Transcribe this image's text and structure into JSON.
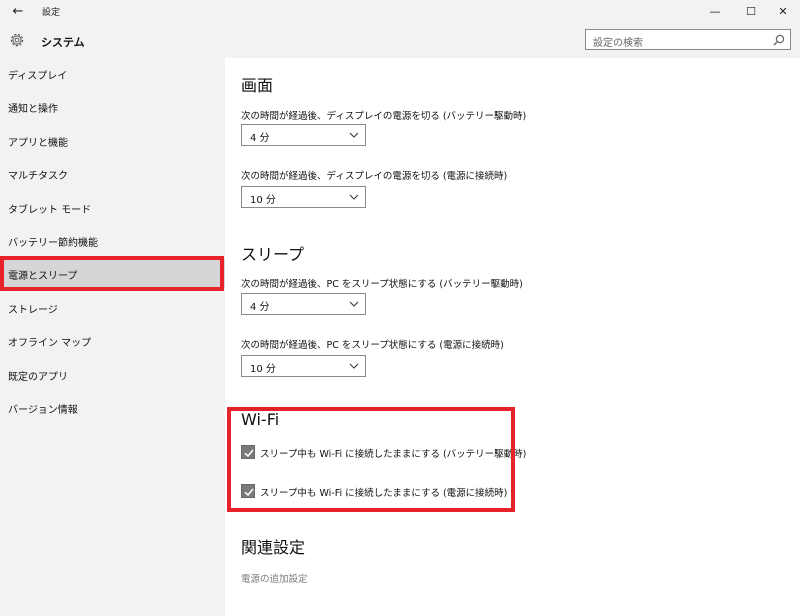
{
  "window": {
    "back_glyph": "←",
    "title": "設定",
    "minimize_glyph": "—",
    "maximize_glyph": "☐",
    "close_glyph": "✕"
  },
  "header": {
    "icon": "gear-icon",
    "title": "システム",
    "search_placeholder": "設定の検索",
    "search_icon": "search-icon"
  },
  "sidebar": {
    "items": [
      {
        "label": "ディスプレイ"
      },
      {
        "label": "通知と操作"
      },
      {
        "label": "アプリと機能"
      },
      {
        "label": "マルチタスク"
      },
      {
        "label": "タブレット モード"
      },
      {
        "label": "バッテリー節約機能"
      },
      {
        "label": "電源とスリープ",
        "selected": true
      },
      {
        "label": "ストレージ"
      },
      {
        "label": "オフライン マップ"
      },
      {
        "label": "既定のアプリ"
      },
      {
        "label": "バージョン情報"
      }
    ],
    "highlight_color": "#e8222b"
  },
  "screen": {
    "heading": "画面",
    "battery_label": "次の時間が経過後、ディスプレイの電源を切る (バッテリー駆動時)",
    "battery_value": "4 分",
    "plugged_label": "次の時間が経過後、ディスプレイの電源を切る (電源に接続時)",
    "plugged_value": "10 分"
  },
  "sleep": {
    "heading": "スリープ",
    "battery_label": "次の時間が経過後、PC をスリープ状態にする (バッテリー駆動時)",
    "battery_value": "4 分",
    "plugged_label": "次の時間が経過後、PC をスリープ状態にする (電源に接続時)",
    "plugged_value": "10 分"
  },
  "wifi": {
    "heading": "Wi-Fi",
    "battery_label": "スリープ中も Wi-Fi に接続したままにする (バッテリー駆動時)",
    "battery_checked": true,
    "plugged_label": "スリープ中も Wi-Fi に接続したままにする (電源に接続時)",
    "plugged_checked": true
  },
  "related": {
    "heading": "関連設定",
    "link": "電源の追加設定"
  }
}
